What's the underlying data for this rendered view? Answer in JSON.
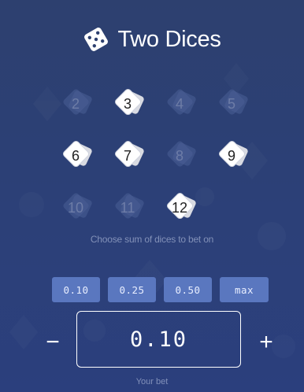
{
  "app": {
    "title": "Two Dices",
    "title_icon": "dice-icon"
  },
  "sums": [
    {
      "value": "2",
      "selected": false
    },
    {
      "value": "3",
      "selected": true
    },
    {
      "value": "4",
      "selected": false
    },
    {
      "value": "5",
      "selected": false
    },
    {
      "value": "6",
      "selected": true
    },
    {
      "value": "7",
      "selected": true
    },
    {
      "value": "8",
      "selected": false
    },
    {
      "value": "9",
      "selected": true
    },
    {
      "value": "10",
      "selected": false
    },
    {
      "value": "11",
      "selected": false
    },
    {
      "value": "12",
      "selected": true
    }
  ],
  "hint": "Choose sum of dices to bet on",
  "bet_options": [
    "0.10",
    "0.25",
    "0.50",
    "max"
  ],
  "bet": {
    "minus_label": "−",
    "value": "0.10",
    "plus_label": "+",
    "label": "Your bet"
  },
  "colors": {
    "background": "#2c3f73",
    "button": "#5a77bf",
    "chip_selected": "#ffffff",
    "chip_unselected": "#4a5e96"
  }
}
